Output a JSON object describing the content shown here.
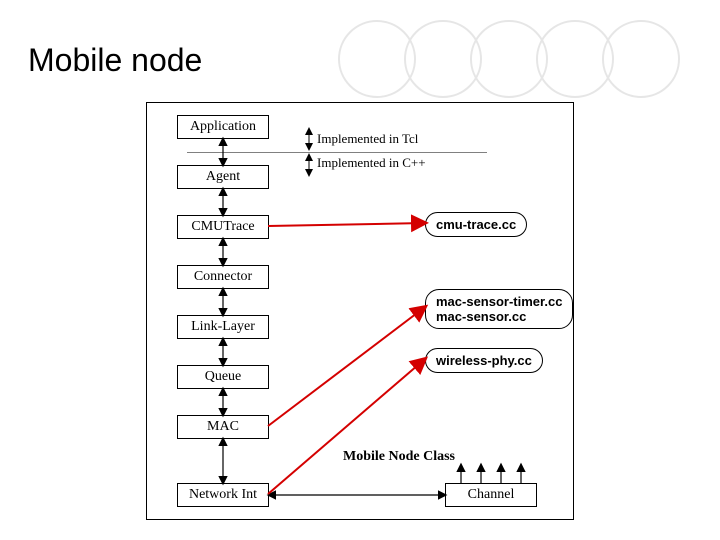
{
  "title": "Mobile node",
  "boxes": {
    "application": "Application",
    "agent": "Agent",
    "cmutrace": "CMUTrace",
    "connector": "Connector",
    "linklayer": "Link-Layer",
    "queue": "Queue",
    "mac": "MAC",
    "netint": "Network Int",
    "channel": "Channel"
  },
  "labels": {
    "impl_tcl": "Implemented in Tcl",
    "impl_cpp": "Implemented in C++",
    "mobile_node_class": "Mobile Node Class"
  },
  "callouts": {
    "cmu": "cmu-trace.cc",
    "mac1": "mac-sensor-timer.cc",
    "mac2": "mac-sensor.cc",
    "phy": "wireless-phy.cc"
  }
}
